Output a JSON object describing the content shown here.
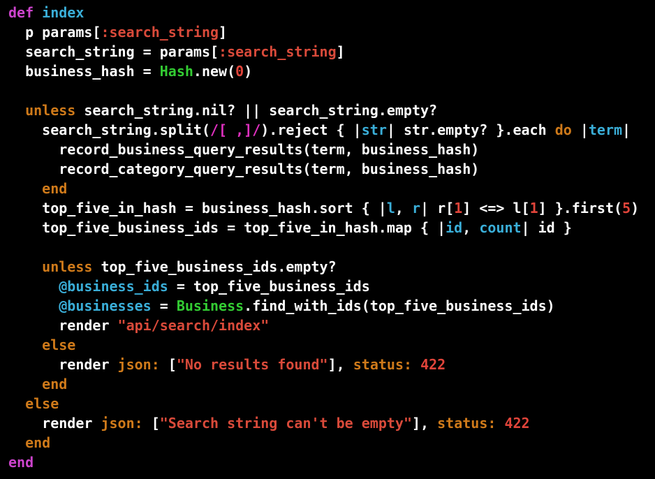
{
  "colors": {
    "background": "#000000",
    "plain": "#ffffff",
    "keyword": "#cc44cc",
    "control": "#cf7a1a",
    "string": "#d94a3a",
    "number": "#e0443a",
    "constant": "#33cc33",
    "ivar": "#3aaed8",
    "ident": "#3aaed8",
    "regex": "#e030c0"
  },
  "code": {
    "lines": [
      [
        [
          "keyword",
          "def "
        ],
        [
          "ident",
          "index"
        ]
      ],
      [
        [
          "plain",
          "  p params["
        ],
        [
          "string",
          ":search_string"
        ],
        [
          "plain",
          "]"
        ]
      ],
      [
        [
          "plain",
          "  search_string = params["
        ],
        [
          "string",
          ":search_string"
        ],
        [
          "plain",
          "]"
        ]
      ],
      [
        [
          "plain",
          "  business_hash = "
        ],
        [
          "constant",
          "Hash"
        ],
        [
          "plain",
          ".new("
        ],
        [
          "number",
          "0"
        ],
        [
          "plain",
          ")"
        ]
      ],
      [
        [
          "plain",
          ""
        ]
      ],
      [
        [
          "control",
          "  unless"
        ],
        [
          "plain",
          " search_string.nil? || search_string.empty?"
        ]
      ],
      [
        [
          "plain",
          "    search_string.split("
        ],
        [
          "regex",
          "/[ ,]/"
        ],
        [
          "plain",
          ").reject { |"
        ],
        [
          "ident",
          "str"
        ],
        [
          "plain",
          "| str.empty? }.each "
        ],
        [
          "control",
          "do"
        ],
        [
          "plain",
          " |"
        ],
        [
          "ident",
          "term"
        ],
        [
          "plain",
          "|"
        ]
      ],
      [
        [
          "plain",
          "      record_business_query_results(term, business_hash)"
        ]
      ],
      [
        [
          "plain",
          "      record_category_query_results(term, business_hash)"
        ]
      ],
      [
        [
          "control",
          "    end"
        ]
      ],
      [
        [
          "plain",
          "    top_five_in_hash = business_hash.sort { |"
        ],
        [
          "ident",
          "l"
        ],
        [
          "plain",
          ", "
        ],
        [
          "ident",
          "r"
        ],
        [
          "plain",
          "| r["
        ],
        [
          "number",
          "1"
        ],
        [
          "plain",
          "] <=> l["
        ],
        [
          "number",
          "1"
        ],
        [
          "plain",
          "] }.first("
        ],
        [
          "number",
          "5"
        ],
        [
          "plain",
          ")"
        ]
      ],
      [
        [
          "plain",
          "    top_five_business_ids = top_five_in_hash.map { |"
        ],
        [
          "ident",
          "id"
        ],
        [
          "plain",
          ", "
        ],
        [
          "ident",
          "count"
        ],
        [
          "plain",
          "| id }"
        ]
      ],
      [
        [
          "plain",
          ""
        ]
      ],
      [
        [
          "control",
          "    unless"
        ],
        [
          "plain",
          " top_five_business_ids.empty?"
        ]
      ],
      [
        [
          "ivar",
          "      @business_ids"
        ],
        [
          "plain",
          " = top_five_business_ids"
        ]
      ],
      [
        [
          "ivar",
          "      @businesses"
        ],
        [
          "plain",
          " = "
        ],
        [
          "constant",
          "Business"
        ],
        [
          "plain",
          ".find_with_ids(top_five_business_ids)"
        ]
      ],
      [
        [
          "plain",
          "      render "
        ],
        [
          "string",
          "\"api/search/index\""
        ]
      ],
      [
        [
          "control",
          "    else"
        ]
      ],
      [
        [
          "plain",
          "      render "
        ],
        [
          "control",
          "json:"
        ],
        [
          "plain",
          " ["
        ],
        [
          "string",
          "\"No results found\""
        ],
        [
          "plain",
          "], "
        ],
        [
          "control",
          "status:"
        ],
        [
          "plain",
          " "
        ],
        [
          "number",
          "422"
        ]
      ],
      [
        [
          "control",
          "    end"
        ]
      ],
      [
        [
          "control",
          "  else"
        ]
      ],
      [
        [
          "plain",
          "    render "
        ],
        [
          "control",
          "json:"
        ],
        [
          "plain",
          " ["
        ],
        [
          "string",
          "\"Search string can't be empty\""
        ],
        [
          "plain",
          "], "
        ],
        [
          "control",
          "status:"
        ],
        [
          "plain",
          " "
        ],
        [
          "number",
          "422"
        ]
      ],
      [
        [
          "control",
          "  end"
        ]
      ],
      [
        [
          "keyword",
          "end"
        ]
      ]
    ]
  }
}
